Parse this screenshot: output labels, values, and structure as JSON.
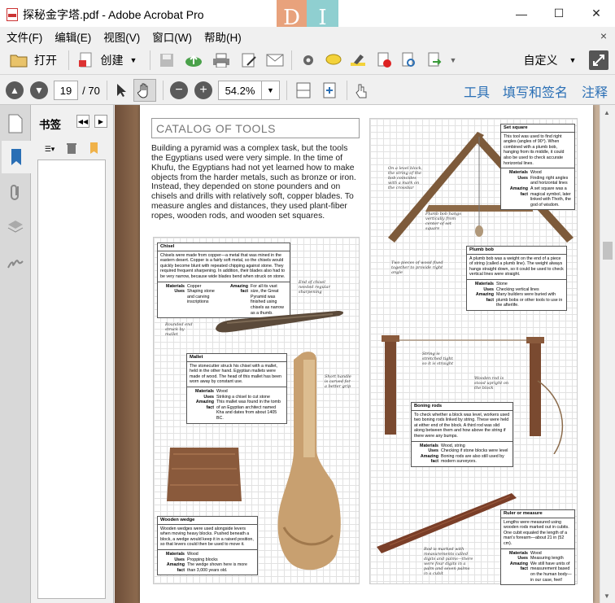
{
  "window": {
    "title": "探秘金字塔.pdf - Adobe Acrobat Pro",
    "brand_left": "D",
    "brand_right": "I"
  },
  "window_controls": {
    "minimize": "—",
    "maximize": "☐",
    "close": "✕"
  },
  "menu": [
    "文件(F)",
    "编辑(E)",
    "视图(V)",
    "窗口(W)",
    "帮助(H)"
  ],
  "menu_close": "×",
  "toolbar": {
    "open_label": "打开",
    "create_label": "创建",
    "customize_label": "自定义"
  },
  "nav": {
    "page_current": "19",
    "page_total": "/ 70",
    "zoom": "54.2%"
  },
  "right_tabs": [
    "工具",
    "填写和签名",
    "注释"
  ],
  "bookmarks": {
    "title": "书签"
  },
  "doc": {
    "left": {
      "heading": "CATALOG OF TOOLS",
      "intro": "Building a pyramid was a complex task, but the tools the Egyptians used were very simple. In the time of Khufu, the Egyptians had not yet learned how to make objects from the harder metals, such as bronze or iron. Instead, they depended on stone pounders and on chisels and drills with relatively soft, copper blades. To measure angles and distances, they used plant-fiber ropes, wooden rods, and wooden set squares.",
      "chisel": {
        "title": "Chisel",
        "body": "Chisels were made from copper—a metal that was mined in the eastern desert. Copper is a fairly soft metal, so the chisels would quickly become blunt with repeated chipping against stone. They required frequent sharpening. In addition, their blades also had to be very narrow, because wide blades bend when struck on stone.",
        "materials_k": "Materials",
        "materials_v": "Copper",
        "uses_k": "Uses",
        "uses_v": "Shaping stone and carving inscriptions",
        "fact_k": "Amazing fact",
        "fact_v": "For all its vast size, the Great Pyramid was finished using chisels as narrow as a thumb."
      },
      "label_chisel_end": "End of chisel needed regular sharpening",
      "label_rounded": "Rounded end struck by mallet",
      "mallet": {
        "title": "Mallet",
        "body": "The stonecutter struck his chisel with a mallet, held in the other hand. Egyptian mallets were made of wood. The head of this mallet has been worn away by constant use.",
        "materials_k": "Materials",
        "materials_v": "Wood",
        "uses_k": "Uses",
        "uses_v": "Striking a chisel to cut stone",
        "fact_k": "Amazing fact",
        "fact_v": "This mallet was found in the tomb of an Egyptian architect named Kha and dates from about 1405 BC."
      },
      "label_short_handle": "Short handle is carved for a better grip",
      "wedge": {
        "title": "Wooden wedge",
        "body": "Wooden wedges were used alongside levers when moving heavy blocks. Pushed beneath a block, a wedge would keep it in a raised position, so that levers could then be used to move it.",
        "materials_k": "Materials",
        "materials_v": "Wood",
        "uses_k": "Uses",
        "uses_v": "Propping blocks",
        "fact_k": "Amazing fact",
        "fact_v": "The wedge shown here is more than 3,000 years old."
      }
    },
    "right": {
      "label_level": "On a level block, the string of the bob coincides with a mark on the crossbar",
      "label_plumb": "Plumb bob hangs vertically from center of set square",
      "label_two_pieces": "Two pieces of wood fixed together to provide right angle",
      "set_square": {
        "title": "Set square",
        "body": "This tool was used to find right angles (angles of 90°). When combined with a plumb bob, hanging from its middle, it could also be used to check accurate horizontal lines.",
        "materials_k": "Materials",
        "materials_v": "Wood",
        "uses_k": "Uses",
        "uses_v": "Finding right angles and horizontal lines",
        "fact_k": "Amazing fact",
        "fact_v": "A set square was a magical symbol, later linked with Thoth, the god of wisdom."
      },
      "plumb_bob": {
        "title": "Plumb bob",
        "body": "A plumb bob was a weight on the end of a piece of string (called a plumb line). The weight always hangs straight down, so it could be used to check vertical lines were straight.",
        "materials_k": "Materials",
        "materials_v": "Stone",
        "uses_k": "Uses",
        "uses_v": "Checking vertical lines",
        "fact_k": "Amazing fact",
        "fact_v": "Many builders were buried with plumb bobs or other tools to use in the afterlife."
      },
      "label_string": "String is stretched tight so it is straight",
      "label_wooden_rod": "Wooden rod is stood upright on the block",
      "boning_rods": {
        "title": "Boning rods",
        "body": "To check whether a block was level, workers used two boning rods linked by string. These were held at either end of the block. A third rod was slid along between them and how above the string if there were any bumps.",
        "materials_k": "Materials",
        "materials_v": "Wood, string",
        "uses_k": "Uses",
        "uses_v": "Checking if stone blocks were level",
        "fact_k": "Amazing fact",
        "fact_v": "Boning rods are also still used by modern surveyors."
      },
      "label_rod_marked": "Rod is marked with measurements called digits and palms—there were four digits in a palm and seven palms in a cubit",
      "ruler": {
        "title": "Ruler or measure",
        "body": "Lengths were measured using wooden rods marked out in cubits. One cubit equaled the length of a man's forearm—about 21 in (52 cm).",
        "materials_k": "Materials",
        "materials_v": "Wood",
        "uses_k": "Uses",
        "uses_v": "Measuring length",
        "fact_k": "Amazing fact",
        "fact_v": "We still have units of measurement based on the human body—in our case, feet!"
      }
    }
  }
}
